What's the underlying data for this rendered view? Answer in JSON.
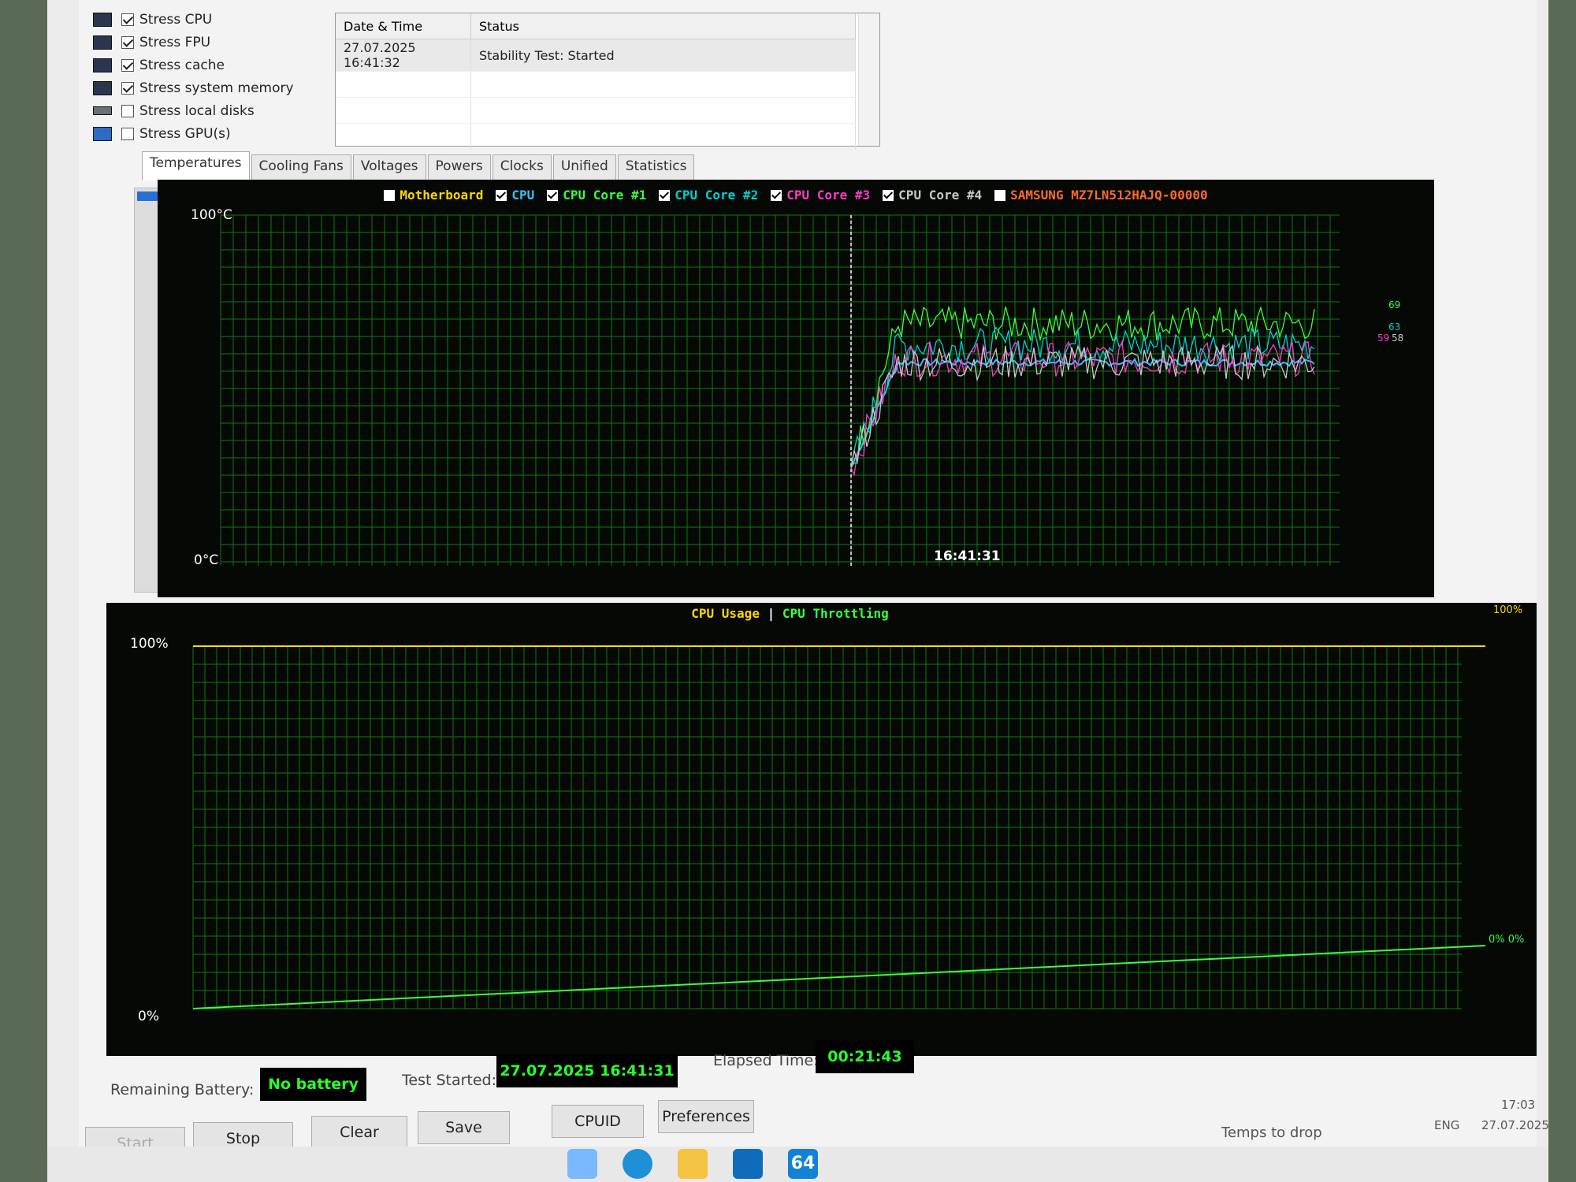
{
  "stress_options": [
    {
      "label": "Stress CPU",
      "checked": true,
      "icon": "cpu-chip-icon"
    },
    {
      "label": "Stress FPU",
      "checked": true,
      "icon": "fpu-chip-icon"
    },
    {
      "label": "Stress cache",
      "checked": true,
      "icon": "cache-chip-icon"
    },
    {
      "label": "Stress system memory",
      "checked": true,
      "icon": "memory-icon"
    },
    {
      "label": "Stress local disks",
      "checked": false,
      "icon": "disk-icon"
    },
    {
      "label": "Stress GPU(s)",
      "checked": false,
      "icon": "gpu-icon"
    }
  ],
  "log": {
    "headers": [
      "Date & Time",
      "Status"
    ],
    "rows": [
      [
        "27.07.2025 16:41:32",
        "Stability Test: Started"
      ]
    ]
  },
  "tabs": [
    "Temperatures",
    "Cooling Fans",
    "Voltages",
    "Powers",
    "Clocks",
    "Unified",
    "Statistics"
  ],
  "active_tab": "Temperatures",
  "temp_chart": {
    "legend": [
      {
        "label": "Motherboard",
        "checked": false,
        "color": "#ffd700"
      },
      {
        "label": "CPU",
        "checked": true,
        "color": "#2ec4ff"
      },
      {
        "label": "CPU Core #1",
        "checked": true,
        "color": "#3cff3c"
      },
      {
        "label": "CPU Core #2",
        "checked": true,
        "color": "#00d2d2"
      },
      {
        "label": "CPU Core #3",
        "checked": true,
        "color": "#ff3cc8"
      },
      {
        "label": "CPU Core #4",
        "checked": true,
        "color": "#c8c8c8"
      },
      {
        "label": "SAMSUNG MZ7LN512HAJQ-00000",
        "checked": false,
        "color": "#ff6a2a"
      }
    ],
    "y_max_label": "100°C",
    "y_min_label": "0°C",
    "marker_time": "16:41:31",
    "end_values": [
      "69",
      "63",
      "59",
      "58"
    ]
  },
  "chart_data": [
    {
      "type": "line",
      "title": "",
      "xlabel": "",
      "ylabel": "",
      "ylim": [
        0,
        100
      ],
      "y_unit": "°C",
      "grid": true,
      "legend_placement": "top",
      "x_tick_labels": [
        "16:41:31"
      ],
      "series": [
        {
          "name": "CPU",
          "color": "#2ec4ff",
          "end_value": 58
        },
        {
          "name": "CPU Core #1",
          "color": "#3cff3c",
          "end_value": 69
        },
        {
          "name": "CPU Core #2",
          "color": "#00d2d2",
          "end_value": 63
        },
        {
          "name": "CPU Core #3",
          "color": "#ff3cc8",
          "end_value": 59
        },
        {
          "name": "CPU Core #4",
          "color": "#c8c8c8",
          "end_value": 58
        }
      ]
    },
    {
      "type": "line",
      "title": "",
      "ylim": [
        0,
        100
      ],
      "y_unit": "%",
      "grid": true,
      "legend_placement": "top",
      "series": [
        {
          "name": "CPU Usage",
          "color": "#ffd700",
          "values": [
            100,
            100
          ]
        },
        {
          "name": "CPU Throttling",
          "color": "#3cff3c",
          "values": [
            0,
            0
          ]
        }
      ]
    }
  ],
  "usage_chart": {
    "legend_usage": "CPU Usage",
    "legend_sep": "|",
    "legend_throttling": "CPU Throttling",
    "y_max_label": "100%",
    "y_min_label": "0%",
    "right_top_value": "100%",
    "right_bottom_value": "0% 0%"
  },
  "status": {
    "remaining_battery_label": "Remaining Battery:",
    "remaining_battery_value": "No battery",
    "test_started_label": "Test Started:",
    "test_started_value": "27.07.2025 16:41:31",
    "elapsed_label": "Elapsed Time:",
    "elapsed_value": "00:21:43"
  },
  "buttons": {
    "start": "Start",
    "stop": "Stop",
    "clear": "Clear",
    "save": "Save",
    "cpuid": "CPUID",
    "preferences": "Preferences"
  },
  "taskbar": {
    "weather_text": "Temps to drop",
    "lang": "ENG",
    "time": "17:03",
    "date": "27.07.2025",
    "app_label": "64"
  }
}
